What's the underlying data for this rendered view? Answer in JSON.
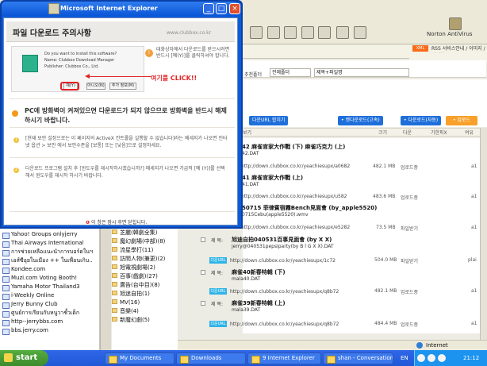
{
  "window": {
    "title": "Microsoft Internet Explorer"
  },
  "dialog": {
    "heading": "파일 다운로드 주의사항",
    "brand": "www.clubbox.co.kr",
    "mini_dialog_lines": [
      "Do you want to install this software?",
      "Name: Clubbox Download Manager",
      "Publisher: Clubbox Co., Ltd."
    ],
    "mini_buttons": [
      "예(Y)",
      "아니오(N)",
      "추가 정보(M)"
    ],
    "click_text": "여기를 CLICK!!",
    "side_note": "대화상자에서 다운로드를 받으시려면 반드시 [예(Y)]를 클릭하셔야 합니다.",
    "warning": "PC에 방화벽이 켜져있으면 다운로드가 되지 않으므로 방화벽을 반드시 해제하시기 바랍니다.",
    "info1": "[현재 보안 설정으로는 이 페이지의 ActiveX 컨트롤을 실행할 수 없습니다]라는 메세지가 나오면 인터넷 옵션 > 보안 에서 보안수준을 [보통] 또는 [낮음]으로 설정하세요.",
    "info2": "다운로드 프로그램 설치 후 [윈도우를 재시작하시겠습니까?] 메세지가 나오면 가급적 [예 (Y)]를 선택해서 윈도우를 재시작 하시기 바랍니다.",
    "close_prefix": "❶",
    "close_text": "이 창은 잠시 후면 닫힙니다."
  },
  "toolbar": {
    "norton": "Norton AntiVirus",
    "xml": "XML",
    "rss": "RSS 서비스안내 / 이미지 / 테이블",
    "tabs": [
      "추천폴더",
      "개통+파일명"
    ]
  },
  "filters": {
    "search1": "전체폴더",
    "search2": "제목+파일명"
  },
  "actions": {
    "download_all": "다운URL 합치기",
    "download_selected": "• 켓다운로드(고속)",
    "download_alt": "• 다운로드(자동)",
    "upload": "• 업로드"
  },
  "table": {
    "headers": [
      "보기",
      "크기",
      "다운",
      "기한피X",
      "여유"
    ],
    "rows": [
      {
        "title": "42 麻雀官家大作戰 (下) 麻雀巧克力 (上)",
        "file": "42.DAT",
        "url": "http://down.clubbox.co.kr/yeachiesupx/a0682",
        "size": "482.1 MB",
        "down": "업로드중",
        "mark": "a1"
      },
      {
        "title": "41 麻雀官家大作戰 (上)",
        "file": "41.DAT",
        "url": "http://down.clubbox.co.kr/yeachiesupx/u582",
        "size": "483.6 MB",
        "down": "업로드중",
        "mark": "a1"
      },
      {
        "title": "50715 菲律賓宿霧Bench見面會 (by_apple5520)",
        "file": "0715Cebu(apple5520).wmv",
        "url": "http://down.clubbox.co.kr/yeachiesupx/e5282",
        "size": "73.5 MB",
        "down": "파일받기",
        "mark": "a1"
      },
      {
        "title": "旭迪自拍040531百事見面會 (by X X)",
        "file": "jerry@040531pepsiparty(by B l G X X).DAT",
        "url": "http://down.clubbox.co.kr/yeachiesupx/1c72",
        "size": "504.0 MB",
        "down": "파일받기",
        "mark": "plai"
      },
      {
        "title": "麻雀40新春特輯 (下)",
        "file": "mala40.DAT",
        "url": "http://down.clubbox.co.kr/yeachiesupx/q8b72",
        "size": "482.1 MB",
        "down": "업로드중",
        "mark": "a1"
      },
      {
        "title": "麻雀39新春特輯 (上)",
        "file": "mala39.DAT",
        "url": "http://down.clubbox.co.kr/yeachiesupx/q8b72",
        "size": "484.4 MB",
        "down": "업로드중",
        "mark": "a1"
      }
    ]
  },
  "sidebar": {
    "items": [
      "Yahoo! Groups onlyjerry",
      "Thai Airways International",
      "การช่วยเหลือแนะนำการบอร์ดในฯ",
      "เอส์ซีอุยในเมือง ++ ในเพื่อนเกิบ..",
      "Kondee.com",
      "Muzi.com Voting Booth!",
      "Yamaha Motor Thailand3",
      "i-Weekly Online",
      "Jerry Bunny Club",
      "ศูนย์การเรียนกับหนูวาชั้วเด็ก",
      "http--jerrybbs.com",
      "bbs.jerry.com"
    ]
  },
  "categories": {
    "items": [
      "芝麗(韓劇全集)",
      "魔幻劇場(中部)(8)",
      "流星學打(11)",
      "訪問人物(兼更)(2)",
      "旭電視劇場(2)",
      "百事(戲劇)(27)",
      "廣告(台中目)(8)",
      "旭迷自拍(1)",
      "MV(16)",
      "音樂(4)",
      "新魔幻劇(5)"
    ]
  },
  "status": {
    "internet": "Internet"
  },
  "taskbar": {
    "start": "start",
    "tasks": [
      "My Documents",
      "Downloads",
      "9 Internet Explorer",
      "shan - Conversation"
    ],
    "lang": "EN",
    "clock": "21:12"
  }
}
